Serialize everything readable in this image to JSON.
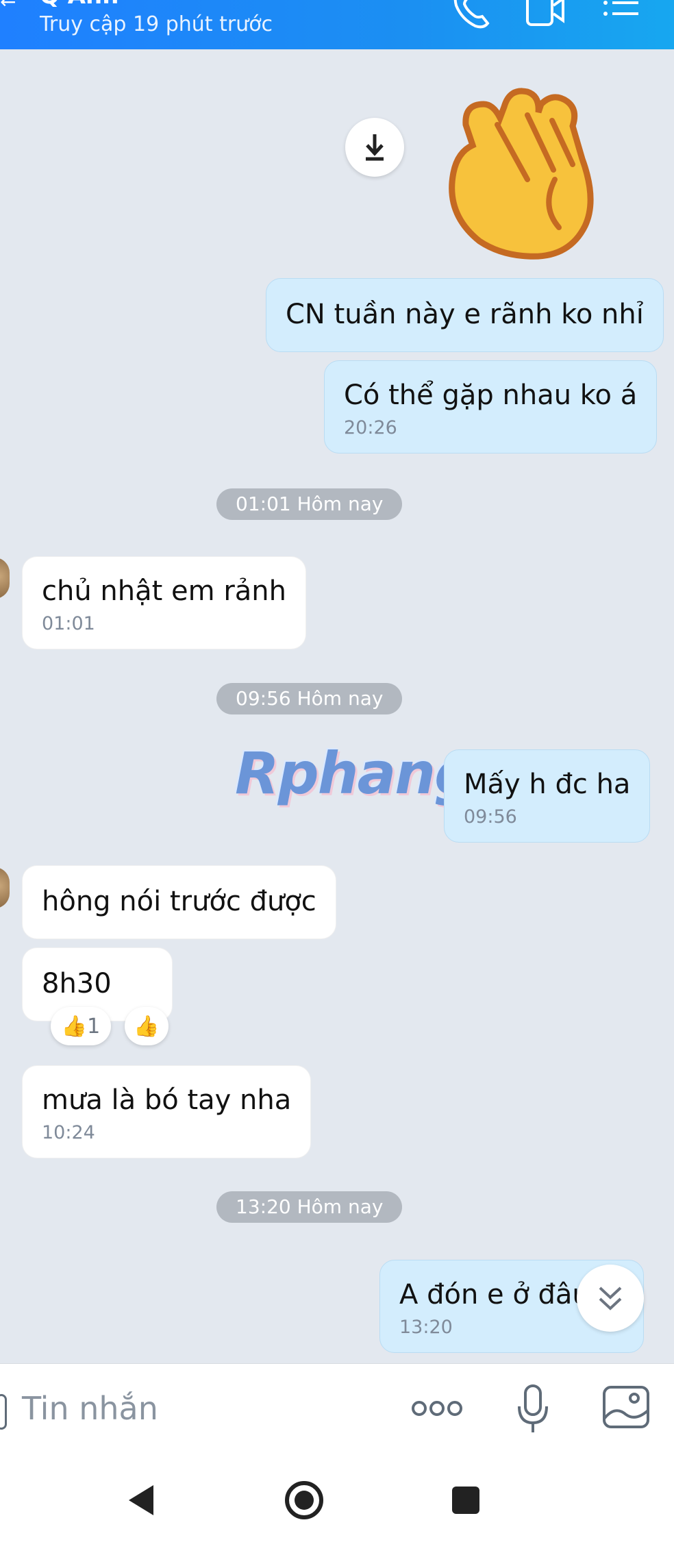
{
  "header": {
    "contact_name": "Q Anh",
    "status": "Truy cập 19 phút trước",
    "icons": [
      "back-arrow-icon",
      "phone-icon",
      "video-call-icon",
      "menu-list-icon"
    ]
  },
  "messages": {
    "m1": {
      "text": "CN tuần này e rãnh ko nhỉ"
    },
    "m2": {
      "text": "Có thể gặp nhau ko á",
      "time": "20:26"
    },
    "sep1": "01:01 Hôm nay",
    "m3": {
      "text": "chủ nhật em rảnh",
      "time": "01:01"
    },
    "sep2": "09:56 Hôm nay",
    "m4": {
      "text": "Mấy h đc ha",
      "time": "09:56"
    },
    "m5": {
      "text": "hông nói trước được"
    },
    "m6": {
      "text": "8h30",
      "reaction_count": "1"
    },
    "m7": {
      "text": "mưa là bó tay nha",
      "time": "10:24"
    },
    "sep3": "13:20 Hôm nay",
    "m8": {
      "text": "A đón e ở đâu",
      "time": "13:20"
    }
  },
  "watermark": "Rphang",
  "input": {
    "placeholder": "Tin nhắn",
    "icons": [
      "more-options-icon",
      "microphone-icon",
      "image-gallery-icon"
    ]
  },
  "navbar": {
    "icons": [
      "nav-back-icon",
      "nav-home-icon",
      "nav-recents-icon"
    ]
  },
  "colors": {
    "header": "#1b8ff2",
    "my_bubble": "#d3edfd",
    "their_bubble": "#ffffff",
    "background": "#e3e8ef"
  }
}
